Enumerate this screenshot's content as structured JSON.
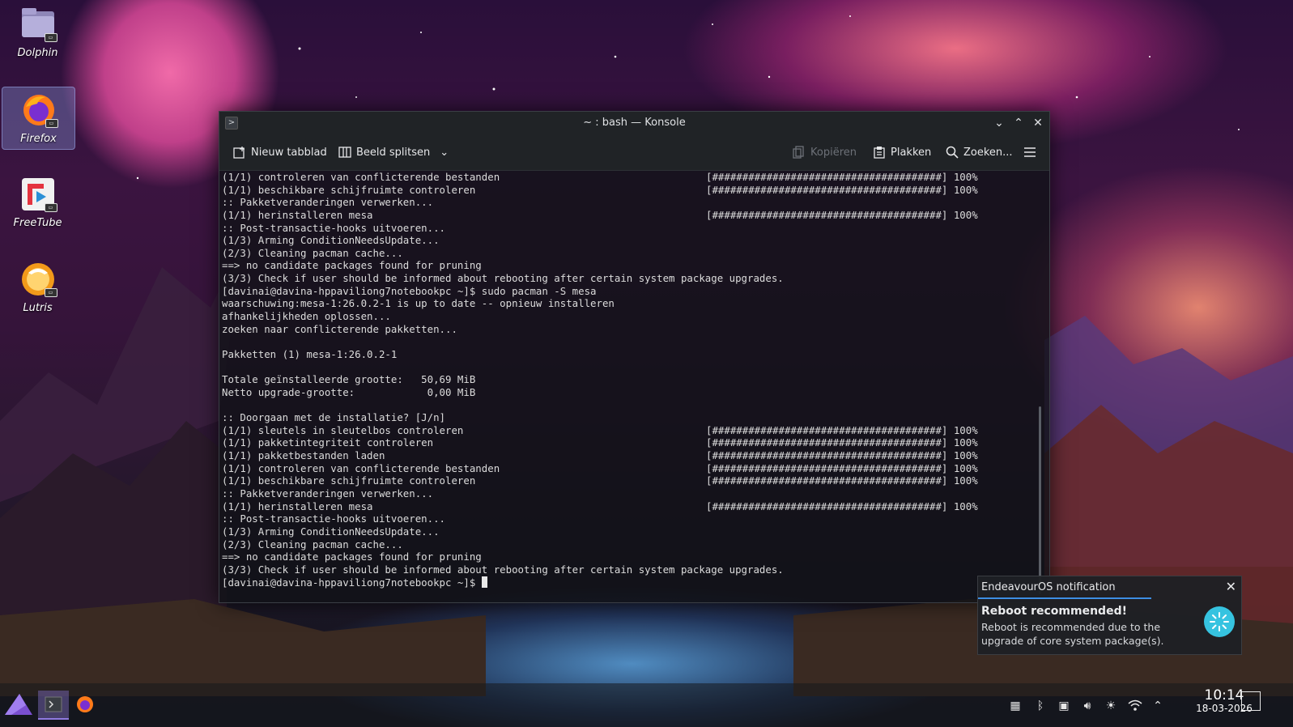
{
  "desktop": {
    "icons": [
      {
        "label": "Dolphin",
        "icon": "folder-icon"
      },
      {
        "label": "Firefox",
        "icon": "firefox-icon"
      },
      {
        "label": "FreeTube",
        "icon": "freetube-icon"
      },
      {
        "label": "Lutris",
        "icon": "lutris-icon"
      }
    ]
  },
  "window": {
    "title": "~ : bash — Konsole",
    "toolbar": {
      "new_tab": "Nieuw tabblad",
      "split_view": "Beeld splitsen",
      "copy": "Kopiëren",
      "paste": "Plakken",
      "search": "Zoeken..."
    },
    "terminal": {
      "lines": [
        {
          "text": "(1/1) controleren van conflicterende bestanden",
          "progress": "[######################################] 100%"
        },
        {
          "text": "(1/1) beschikbare schijfruimte controleren",
          "progress": "[######################################] 100%"
        },
        {
          "text": ":: Pakketveranderingen verwerken...",
          "progress": ""
        },
        {
          "text": "(1/1) herinstalleren mesa",
          "progress": "[######################################] 100%"
        },
        {
          "text": ":: Post-transactie-hooks uitvoeren...",
          "progress": ""
        },
        {
          "text": "(1/3) Arming ConditionNeedsUpdate...",
          "progress": ""
        },
        {
          "text": "(2/3) Cleaning pacman cache...",
          "progress": ""
        },
        {
          "text": "==> no candidate packages found for pruning",
          "progress": ""
        },
        {
          "text": "(3/3) Check if user should be informed about rebooting after certain system package upgrades.",
          "progress": ""
        },
        {
          "text": "[davinai@davina-hppaviliong7notebookpc ~]$ sudo pacman -S mesa",
          "progress": ""
        },
        {
          "text": "waarschuwing:mesa-1:26.0.2-1 is up to date -- opnieuw installeren",
          "progress": ""
        },
        {
          "text": "afhankelijkheden oplossen...",
          "progress": ""
        },
        {
          "text": "zoeken naar conflicterende pakketten...",
          "progress": ""
        },
        {
          "text": "",
          "progress": ""
        },
        {
          "text": "Pakketten (1) mesa-1:26.0.2-1",
          "progress": ""
        },
        {
          "text": "",
          "progress": ""
        },
        {
          "text": "Totale geïnstalleerde grootte:   50,69 MiB",
          "progress": ""
        },
        {
          "text": "Netto upgrade-grootte:            0,00 MiB",
          "progress": ""
        },
        {
          "text": "",
          "progress": ""
        },
        {
          "text": ":: Doorgaan met de installatie? [J/n]",
          "progress": ""
        },
        {
          "text": "(1/1) sleutels in sleutelbos controleren",
          "progress": "[######################################] 100%"
        },
        {
          "text": "(1/1) pakketintegriteit controleren",
          "progress": "[######################################] 100%"
        },
        {
          "text": "(1/1) pakketbestanden laden",
          "progress": "[######################################] 100%"
        },
        {
          "text": "(1/1) controleren van conflicterende bestanden",
          "progress": "[######################################] 100%"
        },
        {
          "text": "(1/1) beschikbare schijfruimte controleren",
          "progress": "[######################################] 100%"
        },
        {
          "text": ":: Pakketveranderingen verwerken...",
          "progress": ""
        },
        {
          "text": "(1/1) herinstalleren mesa",
          "progress": "[######################################] 100%"
        },
        {
          "text": ":: Post-transactie-hooks uitvoeren...",
          "progress": ""
        },
        {
          "text": "(1/3) Arming ConditionNeedsUpdate...",
          "progress": ""
        },
        {
          "text": "(2/3) Cleaning pacman cache...",
          "progress": ""
        },
        {
          "text": "==> no candidate packages found for pruning",
          "progress": ""
        },
        {
          "text": "(3/3) Check if user should be informed about rebooting after certain system package upgrades.",
          "progress": ""
        }
      ],
      "prompt": "[davinai@davina-hppaviliong7notebookpc ~]$ "
    }
  },
  "notification": {
    "app": "EndeavourOS notification",
    "title": "Reboot recommended!",
    "body": "Reboot is recommended due to the upgrade of core system package(s)."
  },
  "panel": {
    "clock_time": "10:14",
    "clock_date": "18-03-2026"
  }
}
